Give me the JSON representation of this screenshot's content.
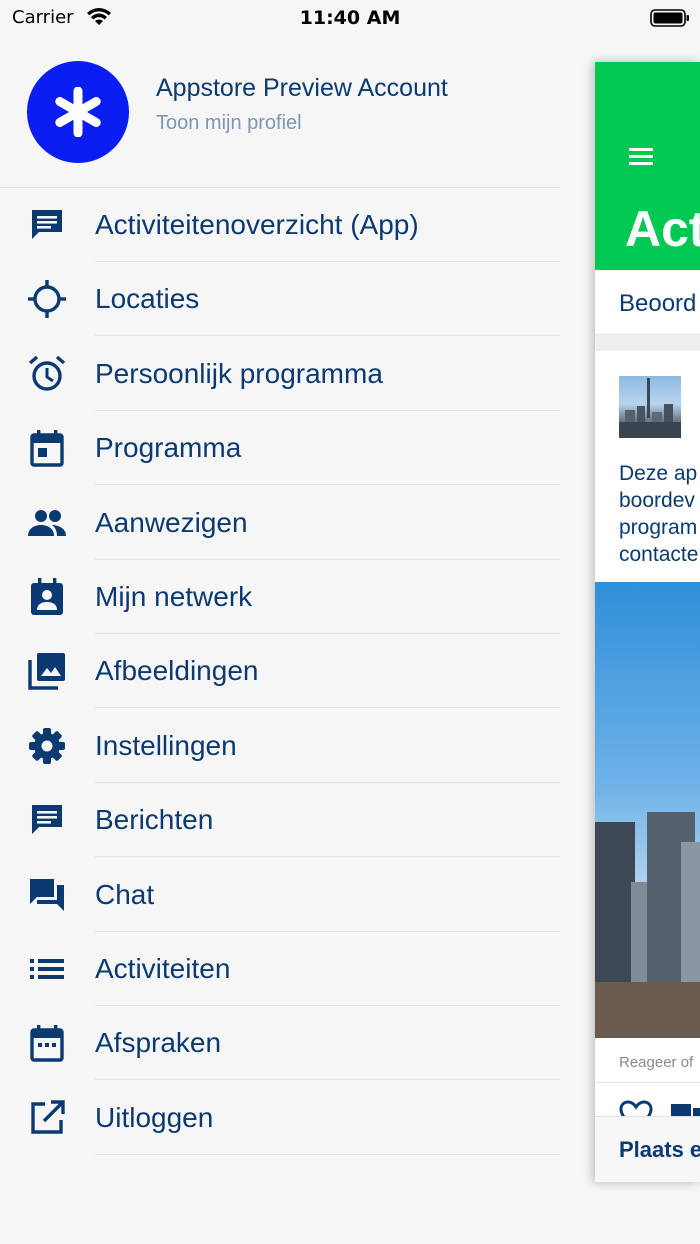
{
  "status_bar": {
    "carrier": "Carrier",
    "time": "11:40 AM",
    "wifi_icon": "wifi-icon",
    "battery_icon": "battery-icon"
  },
  "colors": {
    "avatar_bg": "#0a1ef2",
    "text_primary": "#0b3a72",
    "text_secondary": "#7d96b3",
    "header_green": "#00c853",
    "drawer_bg": "#f6f6f6"
  },
  "profile": {
    "name": "Appstore Preview Account",
    "subtitle": "Toon mijn profiel",
    "avatar_icon": "asterisk-icon"
  },
  "menu": {
    "items": [
      {
        "label": "Activiteitenoverzicht (App)",
        "icon": "feed-icon"
      },
      {
        "label": "Locaties",
        "icon": "crosshair-icon"
      },
      {
        "label": "Persoonlijk programma",
        "icon": "alarm-clock-icon"
      },
      {
        "label": "Programma",
        "icon": "calendar-day-icon"
      },
      {
        "label": "Aanwezigen",
        "icon": "people-icon"
      },
      {
        "label": "Mijn netwerk",
        "icon": "contact-card-icon"
      },
      {
        "label": "Afbeeldingen",
        "icon": "photo-library-icon"
      },
      {
        "label": "Instellingen",
        "icon": "gear-icon"
      },
      {
        "label": "Berichten",
        "icon": "message-icon"
      },
      {
        "label": "Chat",
        "icon": "chat-icon"
      },
      {
        "label": "Activiteiten",
        "icon": "list-icon"
      },
      {
        "label": "Afspraken",
        "icon": "calendar-icon"
      },
      {
        "label": "Uitloggen",
        "icon": "logout-icon"
      }
    ]
  },
  "main": {
    "menu_icon": "hamburger-icon",
    "title": "Act",
    "tab": "Beoord",
    "post_text_lines": [
      "Deze ap",
      "boordev",
      "program",
      "contacte"
    ],
    "reply_hint": "Reageer of",
    "like_icon": "heart-icon",
    "comment_icon": "comment-icon",
    "composer": "Plaats e"
  }
}
